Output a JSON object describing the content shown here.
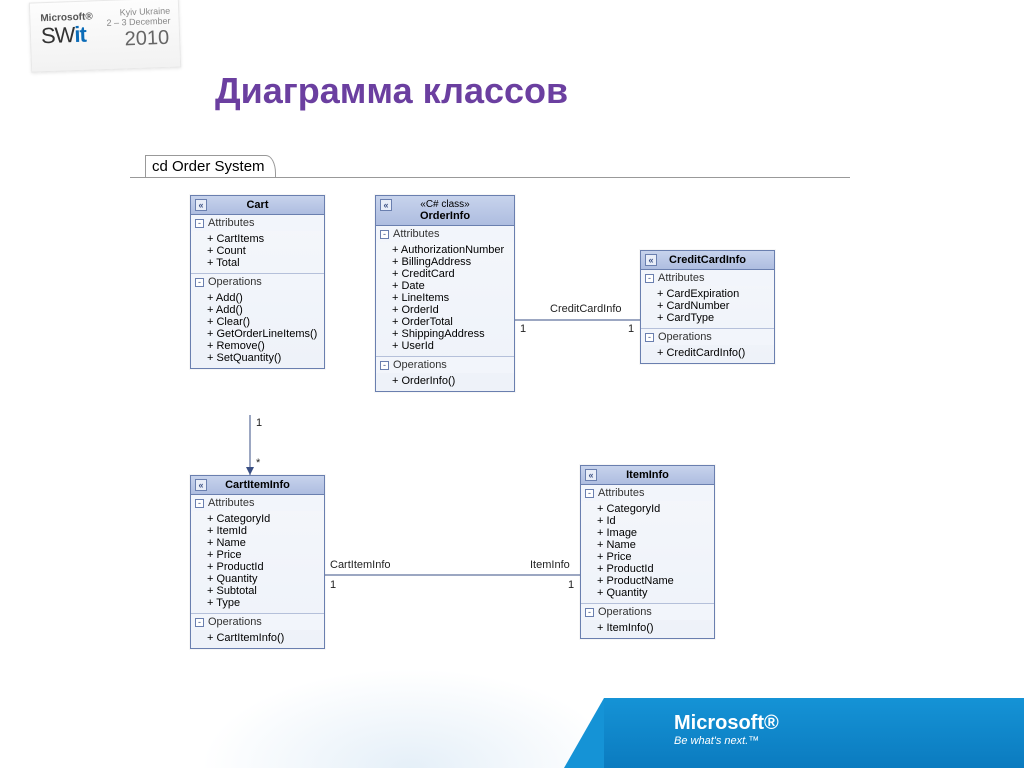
{
  "slide": {
    "title": "Диаграмма классов",
    "diagram_label": "cd Order System"
  },
  "badge": {
    "microsoft": "Microsoft®",
    "swit_prefix": "SW",
    "swit_bold": "it",
    "kyiv": "Kyiv Ukraine",
    "dates": "2 – 3 December",
    "year": "2010"
  },
  "footer": {
    "brand": "Microsoft®",
    "tagline": "Be what's next.™"
  },
  "classes": {
    "cart": {
      "name": "Cart",
      "sections": {
        "attr_label": "Attributes",
        "ops_label": "Operations",
        "attributes": [
          "+ CartItems",
          "+ Count",
          "+ Total"
        ],
        "operations": [
          "+ Add()",
          "+ Add()",
          "+ Clear()",
          "+ GetOrderLineItems()",
          "+ Remove()",
          "+ SetQuantity()"
        ]
      }
    },
    "orderinfo": {
      "stereotype": "«C# class»",
      "name": "OrderInfo",
      "sections": {
        "attr_label": "Attributes",
        "ops_label": "Operations",
        "attributes": [
          "+ AuthorizationNumber",
          "+ BillingAddress",
          "+ CreditCard",
          "+ Date",
          "+ LineItems",
          "+ OrderId",
          "+ OrderTotal",
          "+ ShippingAddress",
          "+ UserId"
        ],
        "operations": [
          "+ OrderInfo()"
        ]
      }
    },
    "creditcard": {
      "name": "CreditCardInfo",
      "sections": {
        "attr_label": "Attributes",
        "ops_label": "Operations",
        "attributes": [
          "+ CardExpiration",
          "+ CardNumber",
          "+ CardType"
        ],
        "operations": [
          "+ CreditCardInfo()"
        ]
      }
    },
    "cartitem": {
      "name": "CartItemInfo",
      "sections": {
        "attr_label": "Attributes",
        "ops_label": "Operations",
        "attributes": [
          "+ CategoryId",
          "+ ItemId",
          "+ Name",
          "+ Price",
          "+ ProductId",
          "+ Quantity",
          "+ Subtotal",
          "+ Type"
        ],
        "operations": [
          "+ CartItemInfo()"
        ]
      }
    },
    "iteminfo": {
      "name": "ItemInfo",
      "sections": {
        "attr_label": "Attributes",
        "ops_label": "Operations",
        "attributes": [
          "+ CategoryId",
          "+ Id",
          "+ Image",
          "+ Name",
          "+ Price",
          "+ ProductId",
          "+ ProductName",
          "+ Quantity"
        ],
        "operations": [
          "+ ItemInfo()"
        ]
      }
    }
  },
  "associations": {
    "order_credit": {
      "label": "CreditCardInfo",
      "left_mult": "1",
      "right_mult": "1"
    },
    "cart_cartitem": {
      "top_mult": "1",
      "bottom_mult": "*"
    },
    "cartitem_item": {
      "left_label": "CartItemInfo",
      "right_label": "ItemInfo",
      "left_mult": "1",
      "right_mult": "1"
    }
  }
}
